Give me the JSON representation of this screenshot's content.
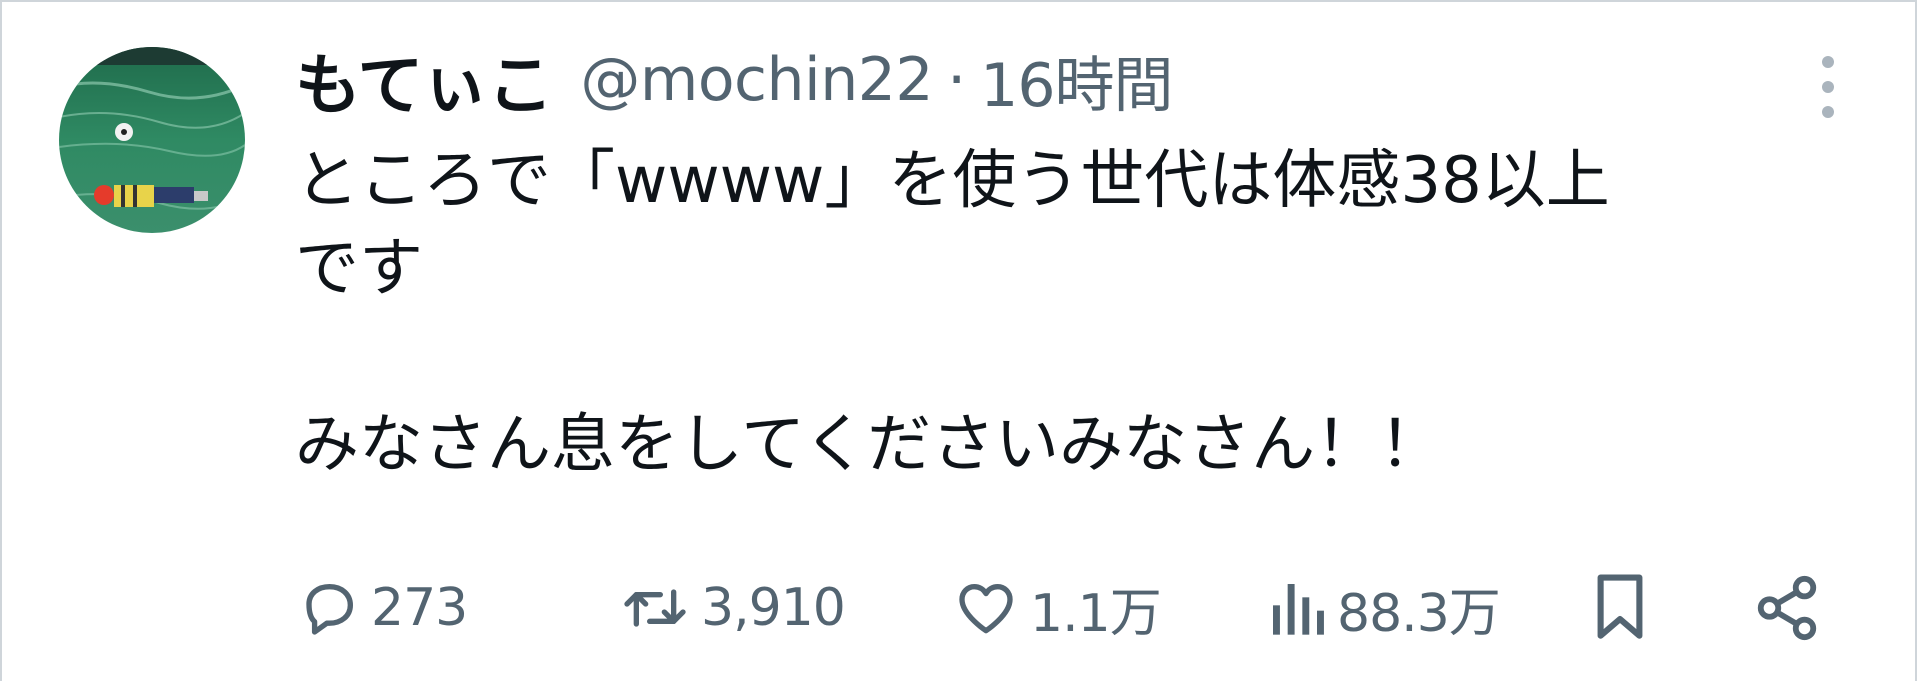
{
  "tweet": {
    "display_name": "もてぃこ",
    "handle": "@mochin22",
    "separator": "·",
    "time": "16時間",
    "text_line1": "ところで「wwww」を使う世代は体感38以上",
    "text_line2": "です",
    "text_line3": "みなさん息をしてくださいみなさん！！"
  },
  "actions": {
    "reply_count": "273",
    "retweet_count": "3,910",
    "like_count": "1.1万",
    "views_count": "88.3万"
  },
  "colors": {
    "text_primary": "#0f1419",
    "text_secondary": "#536471"
  },
  "icons": {
    "avatar": "avatar-image",
    "more": "more-vertical-icon",
    "reply": "reply-icon",
    "retweet": "retweet-icon",
    "like": "heart-icon",
    "views": "views-icon",
    "bookmark": "bookmark-icon",
    "share": "share-icon"
  }
}
